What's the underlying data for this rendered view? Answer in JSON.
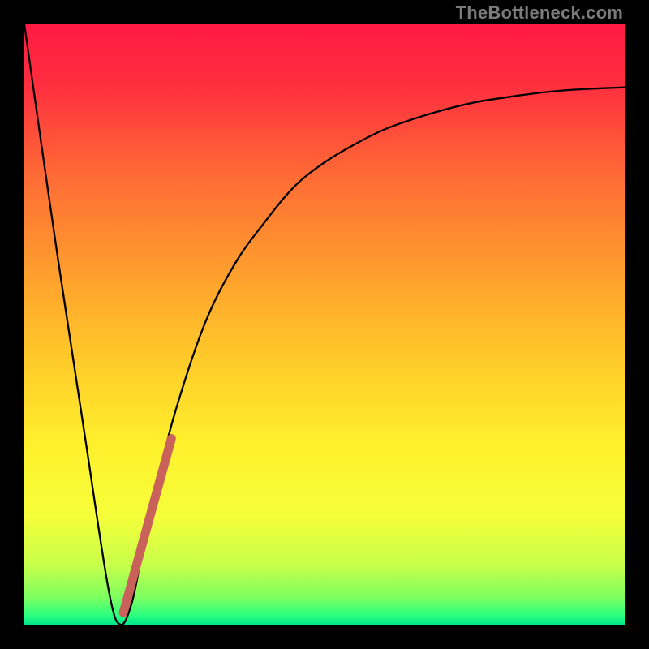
{
  "watermark": "TheBottleneck.com",
  "gradient": {
    "stops": [
      {
        "offset": 0.0,
        "color": "#ff1a44"
      },
      {
        "offset": 0.1,
        "color": "#ff2e3f"
      },
      {
        "offset": 0.25,
        "color": "#ff6a36"
      },
      {
        "offset": 0.4,
        "color": "#ff9a2e"
      },
      {
        "offset": 0.55,
        "color": "#ffc82a"
      },
      {
        "offset": 0.7,
        "color": "#fff02c"
      },
      {
        "offset": 0.82,
        "color": "#f5ff3a"
      },
      {
        "offset": 0.9,
        "color": "#c8ff4a"
      },
      {
        "offset": 0.955,
        "color": "#7dff60"
      },
      {
        "offset": 0.985,
        "color": "#2aff80"
      },
      {
        "offset": 1.0,
        "color": "#00e58a"
      }
    ]
  },
  "chart_data": {
    "type": "line",
    "title": "",
    "xlabel": "",
    "ylabel": "",
    "xlim": [
      0,
      100
    ],
    "ylim": [
      0,
      100
    ],
    "series": [
      {
        "name": "bottleneck-curve",
        "x": [
          0,
          5,
          10,
          14,
          16,
          18,
          20,
          22,
          25,
          30,
          35,
          40,
          45,
          50,
          55,
          60,
          65,
          70,
          75,
          80,
          85,
          90,
          95,
          100
        ],
        "values": [
          100,
          65,
          32,
          6,
          0,
          4,
          14,
          23,
          35,
          50,
          60,
          67,
          73,
          77,
          80,
          82.5,
          84.3,
          85.8,
          87,
          87.8,
          88.5,
          89,
          89.3,
          89.5
        ],
        "stroke": "#000000",
        "stroke_width": 2.3
      },
      {
        "name": "highlight-segment",
        "x": [
          16.5,
          24.5
        ],
        "values": [
          2,
          31
        ],
        "stroke": "#c9625b",
        "stroke_width": 11,
        "linecap": "round"
      }
    ]
  }
}
